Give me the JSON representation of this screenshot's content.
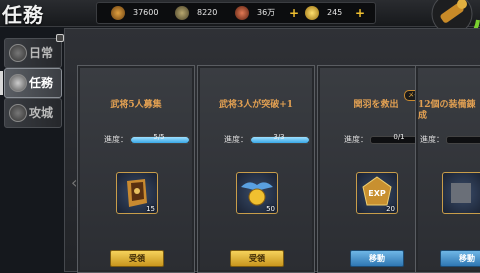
{
  "header": {
    "title": "任務",
    "resources": [
      {
        "icon": "ore-icon",
        "value": "37600",
        "color": "#c9882c"
      },
      {
        "icon": "wood-icon",
        "value": "8220",
        "color": "#8a7a4a"
      },
      {
        "icon": "food-icon",
        "value": "36万",
        "color": "#c86040"
      },
      {
        "icon": "gold-ingot-icon",
        "value": "245",
        "color": "#e0b030"
      }
    ]
  },
  "sidenav": {
    "items": [
      {
        "label": "日常",
        "active": false,
        "locked": true
      },
      {
        "label": "任務",
        "active": true,
        "locked": false
      },
      {
        "label": "攻城",
        "active": false,
        "locked": false
      }
    ]
  },
  "progress_label": "進度：",
  "cards": [
    {
      "title": "武将5人募集",
      "progress_text": "5/5",
      "progress": 1.0,
      "reward_count": "15",
      "reward_icon": "banner-scroll-icon",
      "button": "受領",
      "button_style": "gold",
      "badge": ""
    },
    {
      "title": "武将3人が突破+1",
      "progress_text": "3/3",
      "progress": 1.0,
      "reward_count": "50",
      "reward_icon": "gold-coin-icon",
      "button": "受領",
      "button_style": "gold",
      "badge": ""
    },
    {
      "title": "関羽を救出",
      "progress_text": "0/1",
      "progress": 0.0,
      "reward_count": "20",
      "reward_icon": "exp-icon",
      "button": "移動",
      "button_style": "blue",
      "badge": "メイン"
    },
    {
      "title": "12個の装備錬成",
      "progress_text": "",
      "progress": 0.0,
      "reward_count": "",
      "reward_icon": "gear-icon",
      "button": "移動",
      "button_style": "blue",
      "badge": ""
    }
  ]
}
